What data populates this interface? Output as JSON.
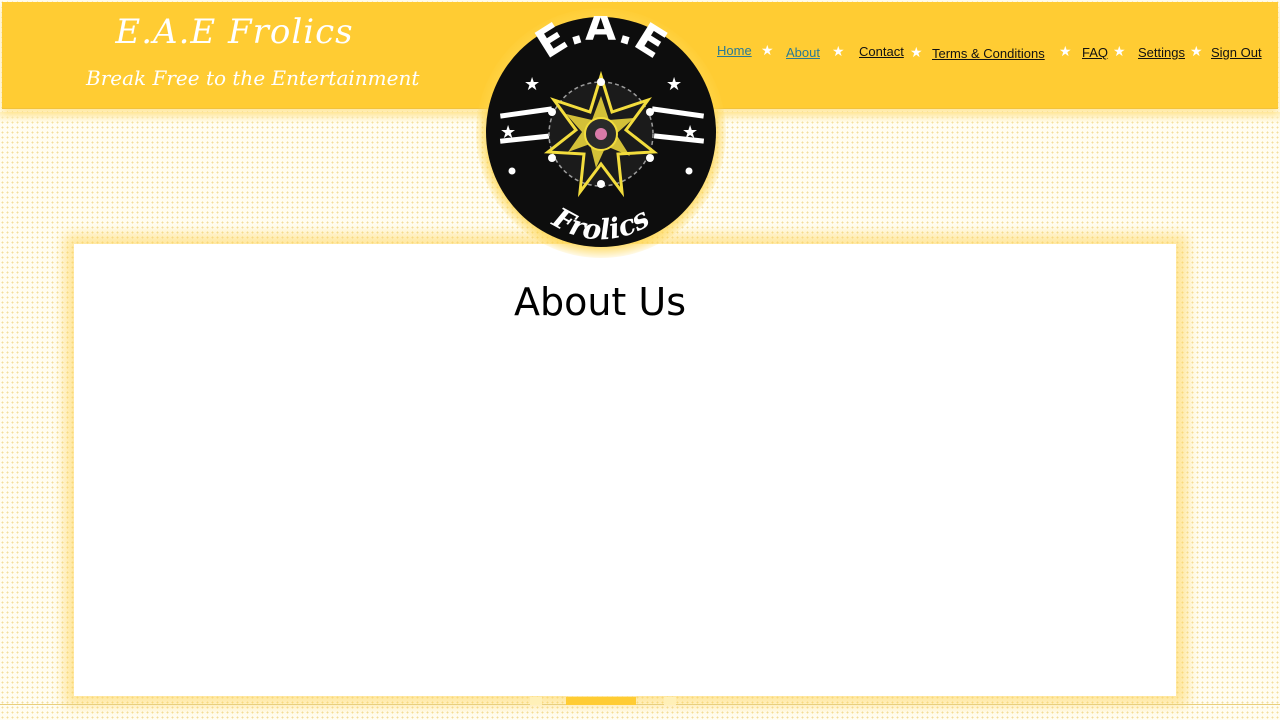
{
  "brand": {
    "title": "E.A.E Frolics",
    "tagline": "Break Free to the Entertainment"
  },
  "nav": {
    "items": [
      {
        "label": "Home"
      },
      {
        "label": "About"
      },
      {
        "label": "Contact"
      },
      {
        "label": "Terms & Conditions"
      },
      {
        "label": "FAQ"
      },
      {
        "label": "Settings"
      },
      {
        "label": "Sign Out"
      }
    ],
    "separator_icon": "star-icon"
  },
  "logo": {
    "top_text": "E.A.E",
    "bottom_text": "Frolics",
    "icon": "mandala-star-icon"
  },
  "main": {
    "title": "About Us"
  },
  "colors": {
    "header_bg": "#ffcc33",
    "nav_active": "#2a7a94",
    "logo_bg": "#0d0d0d",
    "logo_accent": "#f3dd3d",
    "panel_bg": "#ffffff"
  }
}
